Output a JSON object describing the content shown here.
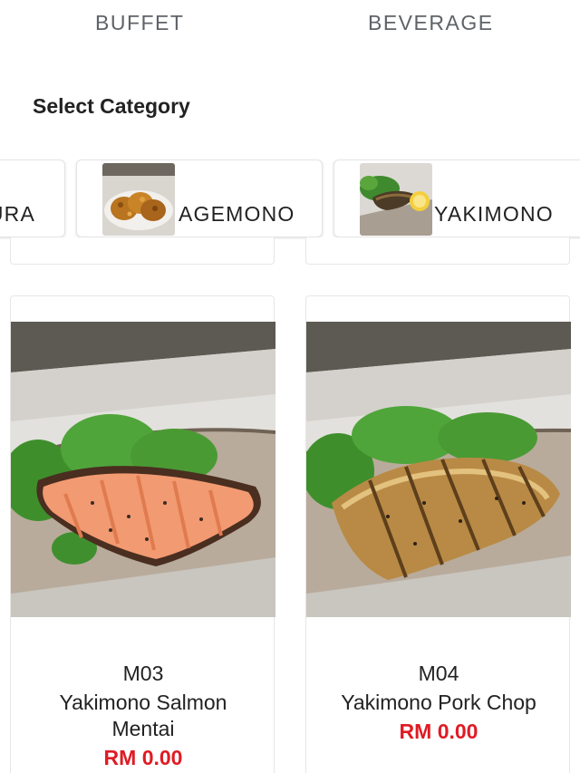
{
  "tabs": [
    {
      "label": "BUFFET"
    },
    {
      "label": "BEVERAGE"
    }
  ],
  "section": {
    "title": "Select Category"
  },
  "categories": [
    {
      "label": "URA",
      "icon": "none"
    },
    {
      "label": "AGEMONO",
      "icon": "fried-chicken-photo"
    },
    {
      "label": "YAKIMONO",
      "icon": "grilled-fish-photo"
    }
  ],
  "items": [
    {
      "code": "M03",
      "name": "Yakimono Salmon Mentai",
      "price": "RM 0.00",
      "icon": "grilled-salmon-photo"
    },
    {
      "code": "M04",
      "name": "Yakimono Pork Chop",
      "price": "RM 0.00",
      "icon": "grilled-pork-photo"
    }
  ],
  "colors": {
    "price": "#e01b24",
    "tab_text": "#5f6368",
    "card_border": "#e6e6e6"
  }
}
